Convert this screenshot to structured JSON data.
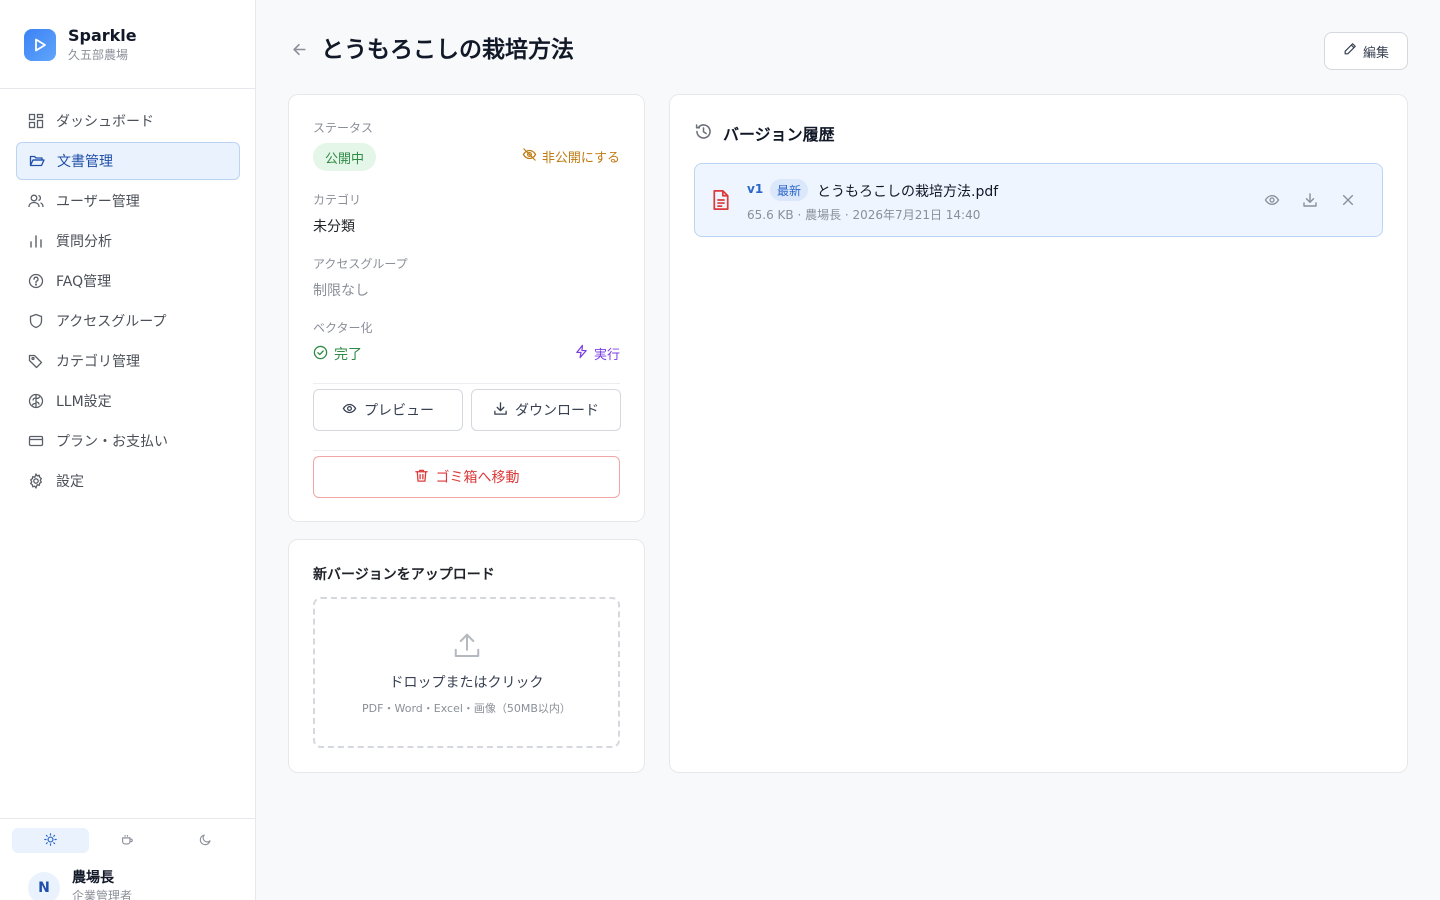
{
  "brand": {
    "name": "Sparkle",
    "org": "久五部農場",
    "accent": "#3b82f6"
  },
  "sidebar": {
    "items": [
      {
        "label": "ダッシュボード",
        "icon": "dashboard-icon"
      },
      {
        "label": "文書管理",
        "icon": "folder-icon",
        "active": true
      },
      {
        "label": "ユーザー管理",
        "icon": "users-icon"
      },
      {
        "label": "質問分析",
        "icon": "bar-chart-icon"
      },
      {
        "label": "FAQ管理",
        "icon": "help-circle-icon"
      },
      {
        "label": "アクセスグループ",
        "icon": "shield-icon"
      },
      {
        "label": "カテゴリ管理",
        "icon": "tag-icon"
      },
      {
        "label": "LLM設定",
        "icon": "brain-icon"
      },
      {
        "label": "プラン・お支払い",
        "icon": "credit-card-icon"
      },
      {
        "label": "設定",
        "icon": "gear-icon"
      }
    ],
    "themes": [
      "sun-icon",
      "coffee-icon",
      "moon-icon"
    ]
  },
  "user": {
    "initial": "N",
    "name": "農場長",
    "role": "企業管理者"
  },
  "header": {
    "title": "とうもろこしの栽培方法",
    "edit_label": "編集"
  },
  "info": {
    "status_label": "ステータス",
    "status_value": "公開中",
    "unpublish_label": "非公開にする",
    "category_label": "カテゴリ",
    "category_value": "未分類",
    "access_label": "アクセスグループ",
    "access_value": "制限なし",
    "vector_label": "ベクター化",
    "vector_value": "完了",
    "run_label": "実行",
    "preview_label": "プレビュー",
    "download_label": "ダウンロード",
    "trash_label": "ゴミ箱へ移動"
  },
  "upload": {
    "title": "新バージョンをアップロード",
    "drop_text": "ドロップまたはクリック",
    "hint": "PDF・Word・Excel・画像（50MB以内）"
  },
  "history": {
    "title": "バージョン履歴",
    "versions": [
      {
        "tag": "v1",
        "latest_label": "最新",
        "file_name": "とうもろこしの栽培方法.pdf",
        "meta": "65.6 KB · 農場長 · 2026年7月21日 14:40"
      }
    ]
  },
  "colors": {
    "success": "#2f8a46",
    "warning": "#c07a12",
    "danger": "#dc3a3a",
    "purple": "#7a3fe0"
  }
}
